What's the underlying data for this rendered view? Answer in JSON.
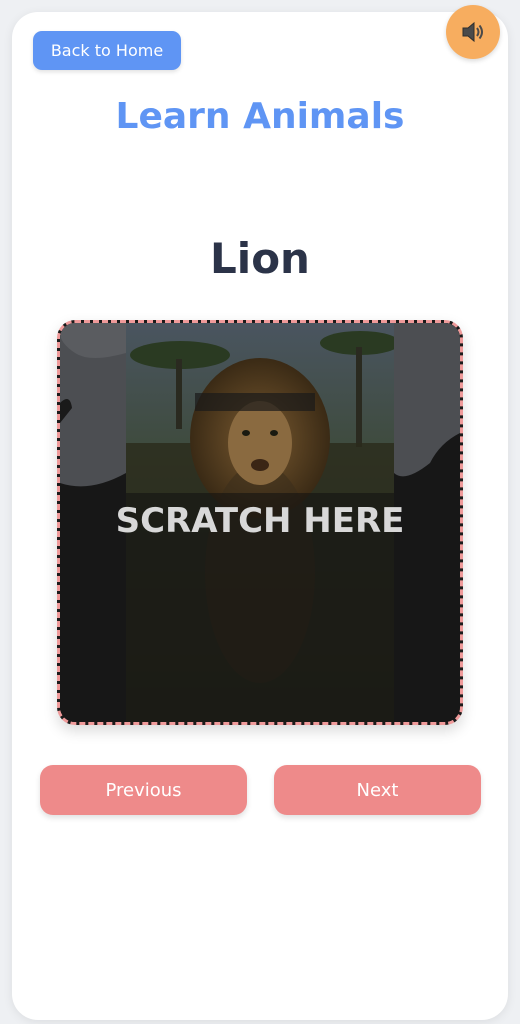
{
  "header": {
    "back_label": "Back to Home",
    "sound_icon": "speaker-icon"
  },
  "page": {
    "title": "Learn Animals",
    "animal_name": "Lion"
  },
  "scratch_card": {
    "overlay_text": "SCRATCH HERE",
    "image_subject": "lion"
  },
  "navigation": {
    "previous_label": "Previous",
    "next_label": "Next"
  },
  "colors": {
    "title_blue": "#5f95f4",
    "nav_button": "#ee8a8a",
    "sound_button": "#f7ad5f",
    "animal_text": "#2b3348"
  }
}
